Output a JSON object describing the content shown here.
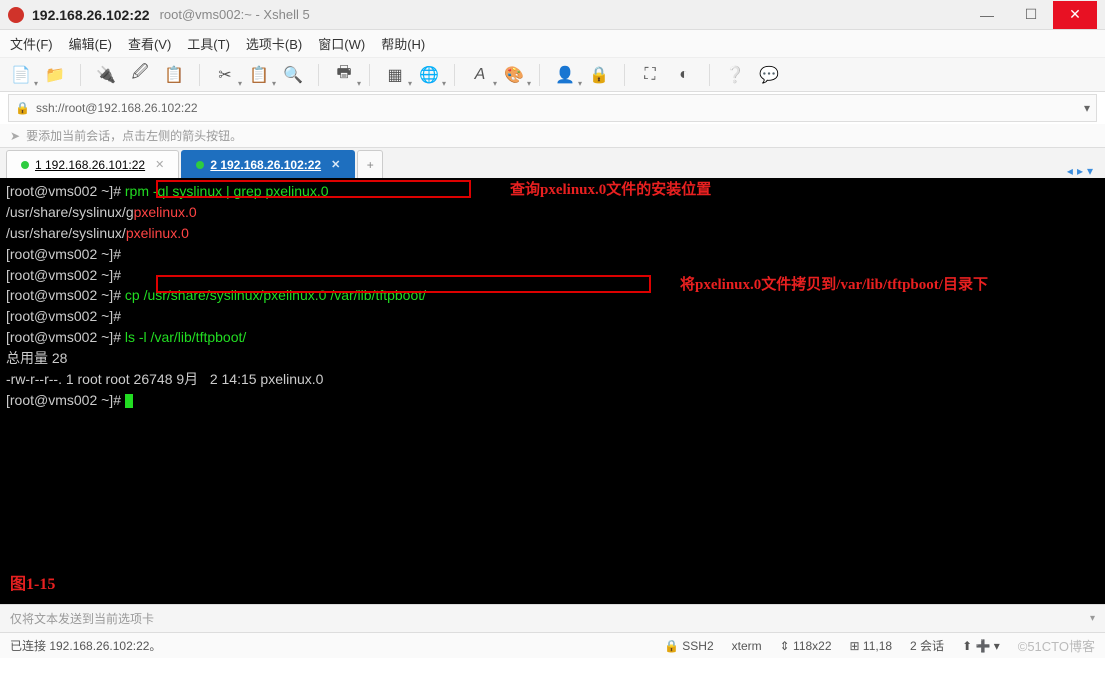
{
  "title": {
    "main": "192.168.26.102:22",
    "sub": "root@vms002:~ - Xshell 5"
  },
  "menu": {
    "file": "文件(F)",
    "edit": "编辑(E)",
    "view": "查看(V)",
    "tools": "工具(T)",
    "tab": "选项卡(B)",
    "window": "窗口(W)",
    "help": "帮助(H)"
  },
  "address": {
    "url": "ssh://root@192.168.26.102:22"
  },
  "hint": {
    "text": "要添加当前会话，点击左侧的箭头按钮。"
  },
  "tabs": [
    {
      "label": "1 192.168.26.101:22",
      "active": false
    },
    {
      "label": "2 192.168.26.102:22",
      "active": true
    }
  ],
  "terminal": {
    "prompt1": "[root@vms002 ~]# ",
    "cmd1": "rpm -ql syslinux | grep pxelinux.0",
    "out1_pref": "/usr/share/syslinux/g",
    "out1_hi": "pxelinux.0",
    "out2_pref": "/usr/share/syslinux/",
    "out2_hi": "pxelinux.0",
    "prompt2": "[root@vms002 ~]#",
    "prompt3": "[root@vms002 ~]#",
    "prompt4": "[root@vms002 ~]# ",
    "cmd2": "cp /usr/share/syslinux/pxelinux.0 /var/lib/tftpboot/",
    "prompt5": "[root@vms002 ~]#",
    "prompt6": "[root@vms002 ~]# ",
    "cmd3": "ls -l /var/lib/tftpboot/",
    "out3": "总用量 28",
    "out4": "-rw-r--r--. 1 root root 26748 9月   2 14:15 pxelinux.0",
    "prompt7": "[root@vms002 ~]# ",
    "annot1": "查询pxelinux.0文件的安装位置",
    "annot2": "将pxelinux.0文件拷贝到/var/lib/tftpboot/目录下",
    "fig": "图1-15"
  },
  "sendbar": {
    "text": "仅将文本发送到当前选项卡"
  },
  "status": {
    "conn": "已连接 192.168.26.102:22。",
    "proto": "SSH2",
    "term": "xterm",
    "size": "118x22",
    "pos": "11,18",
    "sessions": "2 会话",
    "watermark": "©51CTO博客"
  }
}
